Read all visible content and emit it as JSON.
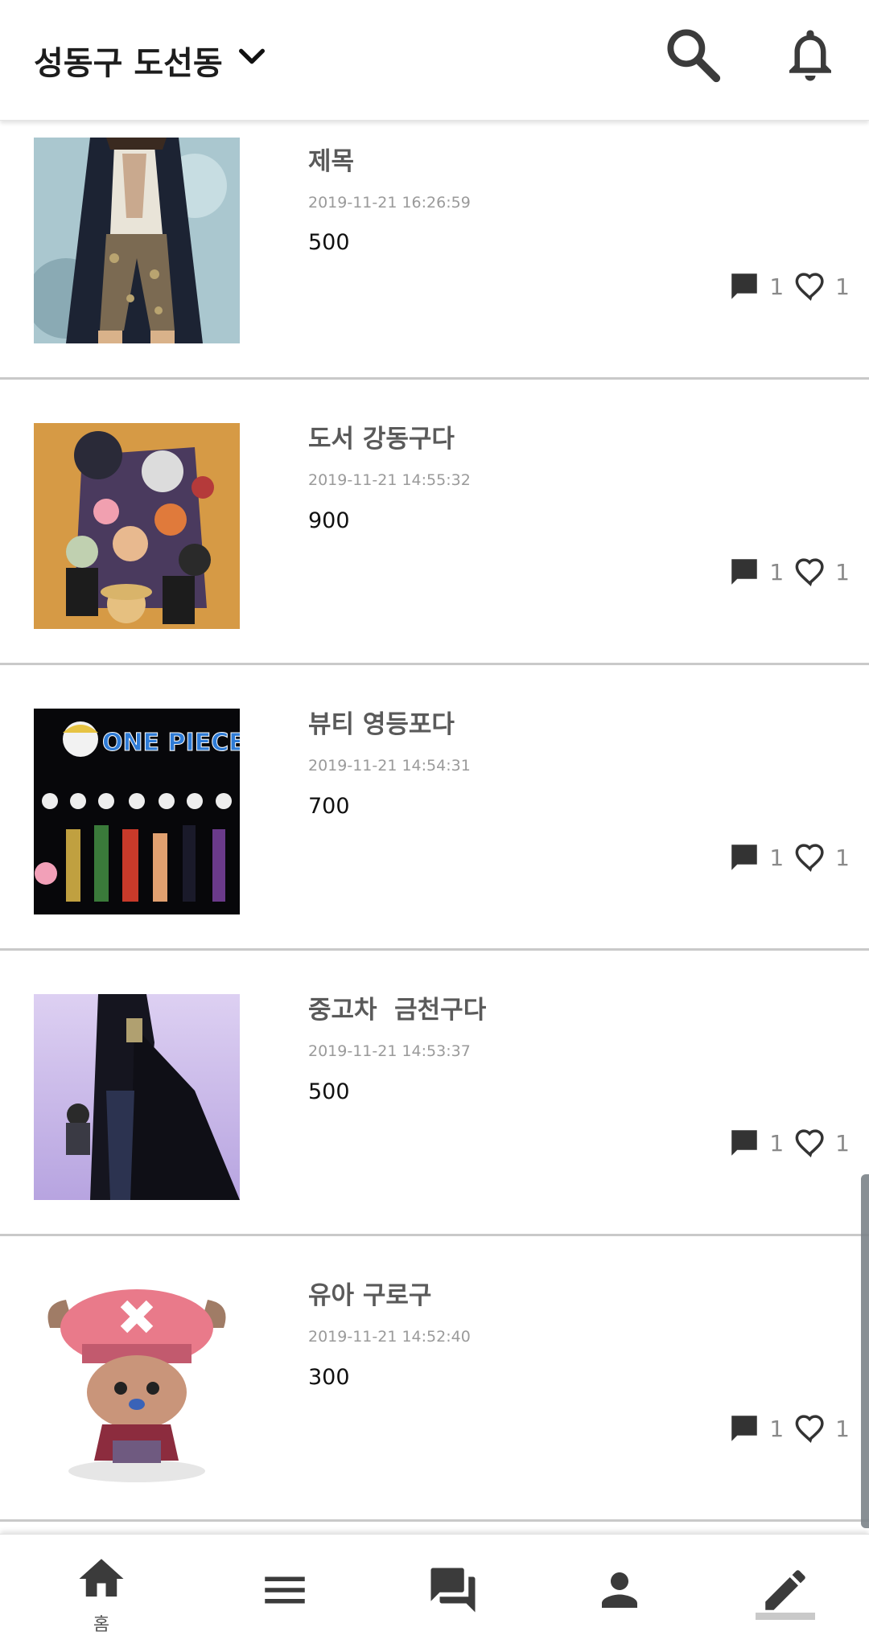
{
  "header": {
    "location": "성동구 도선동",
    "icons": {
      "dropdown": "chevron-down-icon",
      "search": "search-icon",
      "notifications": "bell-icon"
    }
  },
  "items": [
    {
      "title": "제목",
      "date": "2019-11-21 16:26:59",
      "price": "500",
      "comments": "1",
      "likes": "1",
      "image": "character-dark-coat"
    },
    {
      "title": "도서 강동구다",
      "date": "2019-11-21 14:55:32",
      "price": "900",
      "comments": "1",
      "likes": "1",
      "image": "group-portrait-orange"
    },
    {
      "title": "뷰티 영등포다",
      "date": "2019-11-21 14:54:31",
      "price": "700",
      "comments": "1",
      "likes": "1",
      "image": "one-piece-poster"
    },
    {
      "title": "중고차  금천구다",
      "date": "2019-11-21 14:53:37",
      "price": "500",
      "comments": "1",
      "likes": "1",
      "image": "figure-black-cape"
    },
    {
      "title": "유아 구로구",
      "date": "2019-11-21 14:52:40",
      "price": "300",
      "comments": "1",
      "likes": "1",
      "image": "chopper-figure"
    }
  ],
  "poster_text": "ONE PIECE",
  "bottom_nav": {
    "home_label": "홈",
    "icons": [
      "home-icon",
      "menu-icon",
      "chat-icon",
      "person-icon",
      "pencil-icon"
    ]
  },
  "colors": {
    "icon_dark": "#3b3b3b",
    "text_title": "#5a5a5a",
    "text_date": "#9a9a9a",
    "divider": "#c9c9c9"
  }
}
